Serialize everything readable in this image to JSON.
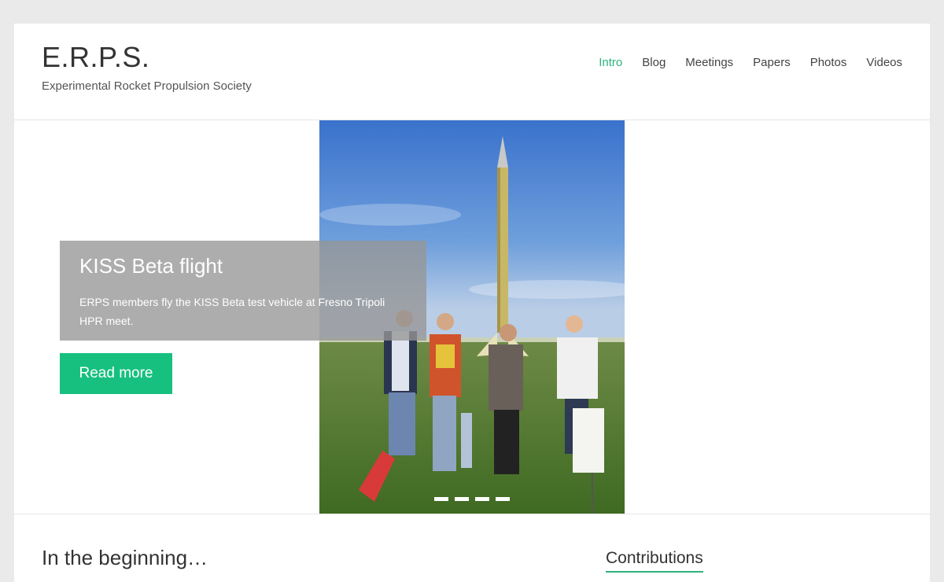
{
  "header": {
    "site_title": "E.R.P.S.",
    "site_description": "Experimental Rocket Propulsion Society"
  },
  "nav": {
    "items": [
      {
        "label": "Intro",
        "active": true
      },
      {
        "label": "Blog"
      },
      {
        "label": "Meetings"
      },
      {
        "label": "Papers"
      },
      {
        "label": "Photos"
      },
      {
        "label": "Videos"
      }
    ]
  },
  "slider": {
    "title": "KISS Beta flight",
    "text": "ERPS members fly the KISS Beta test vehicle at Fresno Tripoli HPR meet.",
    "button": "Read more",
    "slide_count": 4,
    "active_slide": 1
  },
  "content": {
    "section_title": "In the beginning…",
    "widget_title": "Contributions"
  },
  "colors": {
    "accent": "#2db37d",
    "button": "#17c07f"
  }
}
